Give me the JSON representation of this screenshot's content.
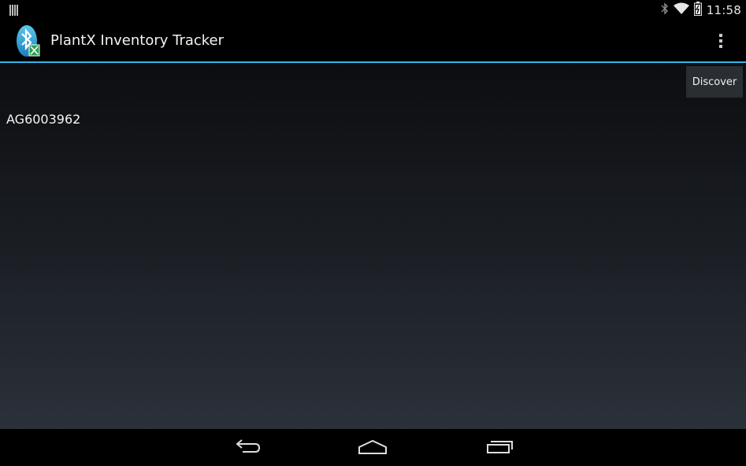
{
  "status_bar": {
    "time": "11:58",
    "icons": [
      "notification-icon",
      "bluetooth-icon",
      "wifi-icon",
      "battery-icon"
    ]
  },
  "action_bar": {
    "title": "PlantX Inventory Tracker",
    "app_icon": "bluetooth-app-icon",
    "overflow_icon": "overflow-menu-icon"
  },
  "content": {
    "discover_label": "Discover",
    "devices": [
      "AG6003962"
    ]
  },
  "nav_bar": {
    "icons": [
      "back-icon",
      "home-icon",
      "recents-icon"
    ]
  },
  "colors": {
    "accent": "#33b5e5",
    "background_top": "#0c0d10",
    "background_bottom": "#2b313a"
  }
}
